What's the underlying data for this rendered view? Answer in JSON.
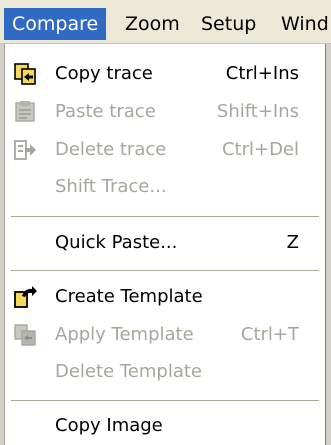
{
  "menubar": {
    "items": [
      "Compare",
      "Zoom",
      "Setup",
      "Wind"
    ]
  },
  "menu": {
    "items": [
      {
        "label": "Copy trace",
        "shortcut": "Ctrl+Ins",
        "enabled": true,
        "icon": "copy-trace-icon"
      },
      {
        "label": "Paste trace",
        "shortcut": "Shift+Ins",
        "enabled": false,
        "icon": "paste-trace-icon"
      },
      {
        "label": "Delete trace",
        "shortcut": "Ctrl+Del",
        "enabled": false,
        "icon": "delete-trace-icon"
      },
      {
        "label": "Shift Trace...",
        "shortcut": "",
        "enabled": false
      },
      {
        "label": "Quick Paste...",
        "shortcut": "Z",
        "enabled": true
      },
      {
        "label": "Create Template",
        "shortcut": "",
        "enabled": true,
        "icon": "create-template-icon"
      },
      {
        "label": "Apply Template",
        "shortcut": "Ctrl+T",
        "enabled": false,
        "icon": "apply-template-icon"
      },
      {
        "label": "Delete Template",
        "shortcut": "",
        "enabled": false
      },
      {
        "label": "Copy Image",
        "shortcut": "",
        "enabled": true
      }
    ]
  },
  "colors": {
    "highlight": "#316ac5",
    "disabled_text": "#a7a69d",
    "menubar_bg": "#ece9d8"
  }
}
